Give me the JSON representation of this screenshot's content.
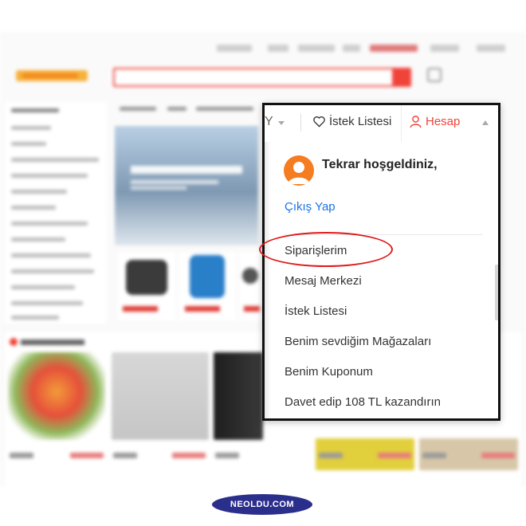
{
  "dropdown": {
    "currency_partial": "Y",
    "wishlist_label": "İstek Listesi",
    "account_label": "Hesap",
    "welcome_text": "Tekrar hoşgeldiniz,",
    "logout_label": "Çıkış Yap",
    "menu_items": [
      "Siparişlerim",
      "Mesaj Merkezi",
      "İstek Listesi",
      "Benim sevdiğim Mağazaları",
      "Benim Kuponum",
      "Davet edip 108 TL kazandırın"
    ]
  },
  "annotation": {
    "highlighted_item": "Siparişlerim",
    "highlight_color": "#e01b1b"
  },
  "watermark": {
    "text": "NEOLDU.COM"
  },
  "colors": {
    "accent": "#f0433a",
    "link": "#1a73e8",
    "avatar": "#f57c1f"
  }
}
